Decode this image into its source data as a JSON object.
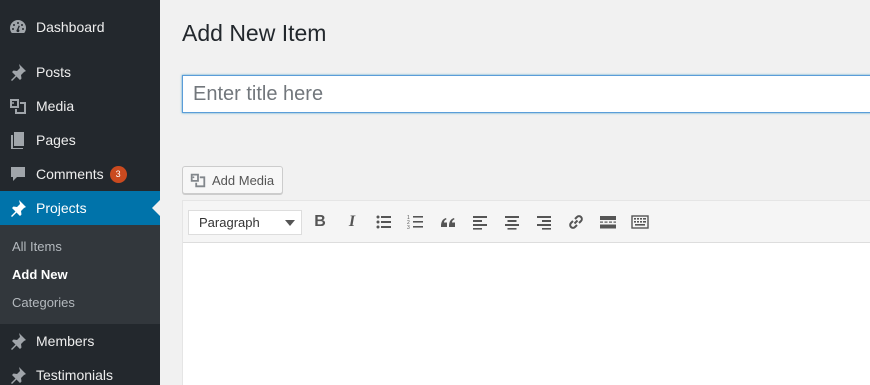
{
  "sidebar": {
    "items": [
      {
        "label": "Dashboard",
        "icon": "dashboard-icon"
      },
      {
        "label": "Posts",
        "icon": "pin-icon"
      },
      {
        "label": "Media",
        "icon": "media-icon"
      },
      {
        "label": "Pages",
        "icon": "pages-icon"
      },
      {
        "label": "Comments",
        "icon": "comment-icon",
        "badge": "3"
      },
      {
        "label": "Projects",
        "icon": "pin-icon",
        "current": true
      },
      {
        "label": "Members",
        "icon": "pin-icon"
      },
      {
        "label": "Testimonials",
        "icon": "pin-icon"
      }
    ],
    "submenu": [
      {
        "label": "All Items"
      },
      {
        "label": "Add New",
        "current": true
      },
      {
        "label": "Categories"
      }
    ]
  },
  "main": {
    "title": "Add New Item",
    "title_placeholder": "Enter title here",
    "add_media_label": "Add Media",
    "format_select": "Paragraph",
    "toolbar_icons": [
      "bold-icon",
      "italic-icon",
      "bullet-list-icon",
      "numbered-list-icon",
      "blockquote-icon",
      "align-left-icon",
      "align-center-icon",
      "align-right-icon",
      "link-icon",
      "read-more-icon",
      "toolbar-toggle-icon"
    ]
  },
  "colors": {
    "sidebar_bg": "#23282d",
    "submenu_bg": "#32373c",
    "accent": "#0073aa",
    "badge": "#ca4a1f",
    "page_bg": "#f1f1f1"
  }
}
